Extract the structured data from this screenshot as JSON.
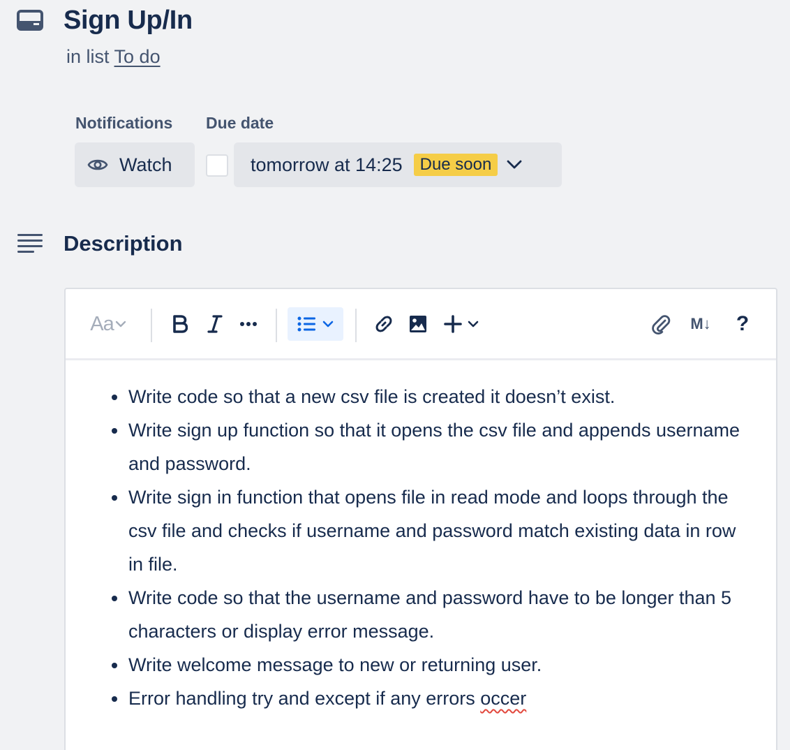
{
  "card": {
    "title": "Sign Up/In",
    "list_prefix": "in list",
    "list_name": "To do"
  },
  "notifications": {
    "label": "Notifications",
    "watch_label": "Watch"
  },
  "due_date": {
    "label": "Due date",
    "checked": false,
    "value": "tomorrow at 14:25",
    "badge": "Due soon",
    "badge_color": "#f5cd47"
  },
  "description": {
    "title": "Description",
    "toolbar": {
      "text_style": "Aa",
      "icons": [
        "text-style-icon",
        "bold-icon",
        "italic-icon",
        "more-formatting-icon",
        "bullet-list-icon",
        "link-icon",
        "image-icon",
        "insert-icon",
        "attachment-icon",
        "markdown-icon",
        "help-icon"
      ],
      "markdown_label": "M↓",
      "help_label": "?"
    },
    "items": [
      "Write code so that a new csv file is created it doesn’t exist.",
      "Write sign up function so that it opens the csv file and appends username and password.",
      "Write sign in function that opens file in read mode and loops through the csv file and checks if username and password match existing data in row in file.",
      "Write code so that the username and password have to be longer than 5 characters or display error message.",
      "Write welcome message to new or returning user.",
      "Error handling try and except if any errors "
    ],
    "misspelled_word": "occer"
  },
  "colors": {
    "background": "#f1f2f4",
    "text": "#172b4d",
    "subtle_text": "#44546f",
    "button_bg": "#e4e6ea",
    "active_tool": "#e9f2ff",
    "accent": "#0c66e4"
  }
}
